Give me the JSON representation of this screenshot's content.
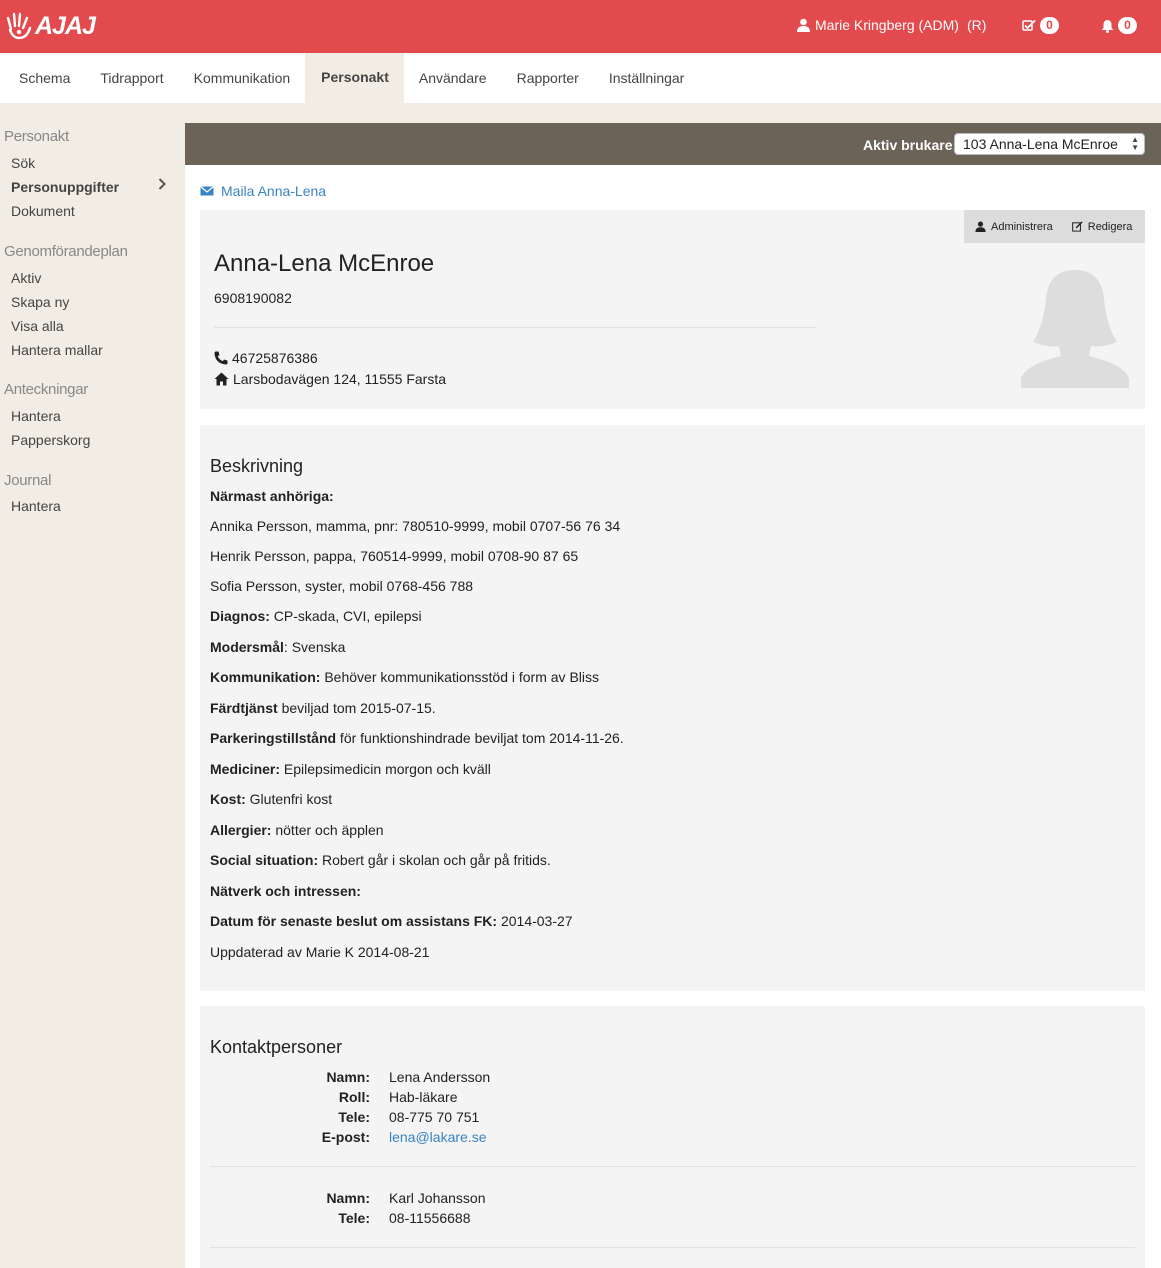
{
  "app": {
    "logo": "AJAJ"
  },
  "topbar": {
    "user": "Marie Kringberg (ADM)",
    "role": "(R)",
    "tasks_count": "0",
    "notifications_count": "0"
  },
  "nav": {
    "tabs": [
      {
        "label": "Schema"
      },
      {
        "label": "Tidrapport"
      },
      {
        "label": "Kommunikation"
      },
      {
        "label": "Personakt",
        "active": true
      },
      {
        "label": "Användare"
      },
      {
        "label": "Rapporter"
      },
      {
        "label": "Inställningar"
      }
    ]
  },
  "sidebar": {
    "sections": [
      {
        "heading": "Personakt",
        "items": [
          "Sök",
          "Personuppgifter",
          "Dokument"
        ]
      },
      {
        "heading": "Genomförandeplan",
        "items": [
          "Aktiv",
          "Skapa ny",
          "Visa alla",
          "Hantera mallar"
        ]
      },
      {
        "heading": "Anteckningar",
        "items": [
          "Hantera",
          "Papperskorg"
        ]
      },
      {
        "heading": "Journal",
        "items": [
          "Hantera"
        ]
      }
    ],
    "active_item": "Personuppgifter"
  },
  "active_user": {
    "label": "Aktiv brukare:",
    "selected": "103 Anna-Lena McEnroe"
  },
  "mail_link": "Maila Anna-Lena",
  "profile": {
    "actions": {
      "admin": "Administrera",
      "edit": "Redigera"
    },
    "name": "Anna-Lena McEnroe",
    "pnr": "6908190082",
    "phone": "46725876386",
    "address": "Larsbodavägen 124, 11555 Farsta"
  },
  "description": {
    "title": "Beskrivning",
    "lines": [
      {
        "bold": "Närmast anhöriga:",
        "text": ""
      },
      {
        "bold": "",
        "text": "Annika Persson, mamma, pnr: 780510-9999, mobil 0707-56 76 34"
      },
      {
        "bold": "",
        "text": "Henrik Persson, pappa, 760514-9999, mobil 0708-90 87 65"
      },
      {
        "bold": "",
        "text": "Sofia Persson, syster, mobil 0768-456 788"
      },
      {
        "bold": "Diagnos:",
        "text": " CP-skada, CVI, epilepsi"
      },
      {
        "bold": "Modersmål",
        "text": ": Svenska"
      },
      {
        "bold": "Kommunikation:",
        "text": " Behöver kommunikationsstöd i form av Bliss"
      },
      {
        "bold": "Färdtjänst",
        "text": " beviljad tom 2015-07-15."
      },
      {
        "bold": "Parkeringstillstånd",
        "text": " för funktionshindrade beviljat tom 2014-11-26."
      },
      {
        "bold": "Mediciner:",
        "text": " Epilepsimedicin morgon och kväll"
      },
      {
        "bold": "Kost:",
        "text": " Glutenfri kost"
      },
      {
        "bold": "Allergier:",
        "text": " nötter och äpplen"
      },
      {
        "bold": "Social situation:",
        "text": " Robert går i skolan och går på fritids."
      },
      {
        "bold": "Nätverk och intressen:",
        "text": ""
      },
      {
        "bold": "Datum för senaste beslut om assistans FK:",
        "text": " 2014-03-27"
      },
      {
        "bold": "",
        "text": "Uppdaterad av Marie K 2014-08-21"
      }
    ]
  },
  "contacts": {
    "title": "Kontaktpersoner",
    "people": [
      {
        "fields": [
          {
            "label": "Namn:",
            "value": "Lena Andersson"
          },
          {
            "label": "Roll:",
            "value": "Hab-läkare"
          },
          {
            "label": "Tele:",
            "value": "08-775 70 751"
          },
          {
            "label": "E-post:",
            "value": "lena@lakare.se",
            "link": true
          }
        ]
      },
      {
        "fields": [
          {
            "label": "Namn:",
            "value": "Karl Johansson"
          },
          {
            "label": "Tele:",
            "value": "08-11556688"
          }
        ]
      }
    ]
  },
  "colors": {
    "brand": "#e24a4d",
    "sidebar_bg": "#f2ede4",
    "userbar_bg": "#6b6258",
    "link": "#3a83c4"
  }
}
